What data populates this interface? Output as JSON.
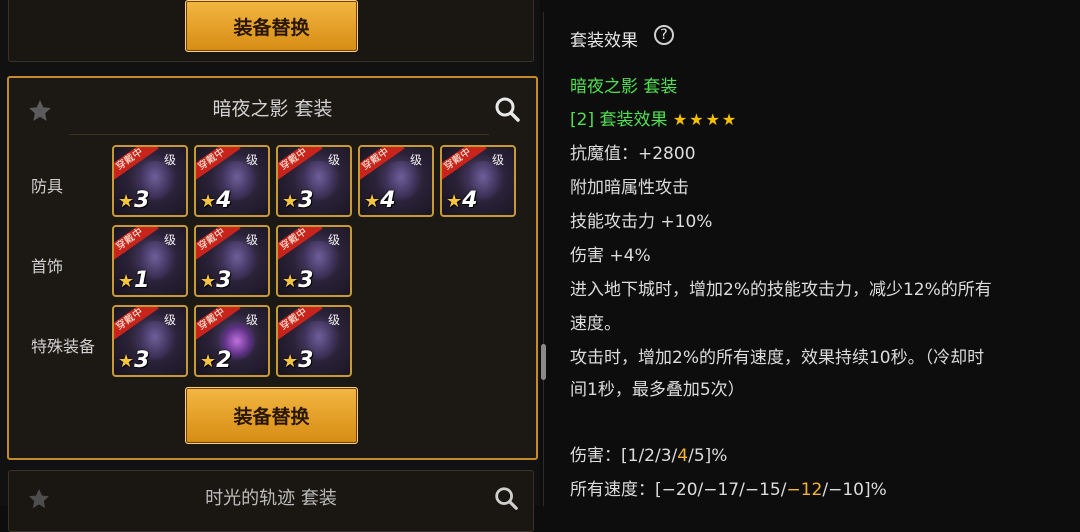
{
  "left_panel": {
    "previous_set": {
      "button_label": "装备替换"
    },
    "current_set": {
      "title": "暗夜之影  套装",
      "rows": [
        {
          "label": "防具",
          "items": [
            {
              "ribbon": "穿戴中",
              "grade": "级",
              "stars": "3"
            },
            {
              "ribbon": "穿戴中",
              "grade": "级",
              "stars": "4"
            },
            {
              "ribbon": "穿戴中",
              "grade": "级",
              "stars": "3"
            },
            {
              "ribbon": "穿戴中",
              "grade": "级",
              "stars": "4"
            },
            {
              "ribbon": "穿戴中",
              "grade": "级",
              "stars": "4"
            }
          ]
        },
        {
          "label": "首饰",
          "items": [
            {
              "ribbon": "穿戴中",
              "grade": "级",
              "stars": "1"
            },
            {
              "ribbon": "穿戴中",
              "grade": "级",
              "stars": "3"
            },
            {
              "ribbon": "穿戴中",
              "grade": "级",
              "stars": "3"
            }
          ]
        },
        {
          "label": "特殊装备",
          "items": [
            {
              "ribbon": "穿戴中",
              "grade": "级",
              "stars": "3"
            },
            {
              "ribbon": "穿戴中",
              "grade": "级",
              "stars": "2"
            },
            {
              "ribbon": "穿戴中",
              "grade": "级",
              "stars": "3"
            }
          ]
        }
      ],
      "button_label": "装备替换"
    },
    "next_set": {
      "title": "时光的轨迹  套装"
    }
  },
  "right_panel": {
    "title": "套装效果",
    "help_icon": "question-circle-icon",
    "set_name": "暗夜之影  套装",
    "bonus_header": "[2] 套装效果",
    "bonus_stars": "★★★★",
    "effects": [
      "抗魔值：+2800",
      "附加暗属性攻击",
      "技能攻击力 +10%",
      "伤害 +4%",
      "进入地下城时，增加2%的技能攻击力，减少12%的所有",
      "速度。",
      "攻击时，增加2%的所有速度，效果持续10秒。（冷却时",
      "间1秒，最多叠加5次）"
    ],
    "damage_line": {
      "prefix": "伤害：[1/2/3/",
      "highlight": "4",
      "suffix": "/5]%"
    },
    "speed_line": {
      "prefix": "所有速度：[−20/−17/−15/",
      "highlight": "−12",
      "suffix": "/−10]%"
    }
  },
  "colors": {
    "accent_gold": "#f0b13a",
    "set_name_green": "#4fe04f",
    "highlight_orange": "#f6b531",
    "border_gold": "#c58a2a"
  }
}
